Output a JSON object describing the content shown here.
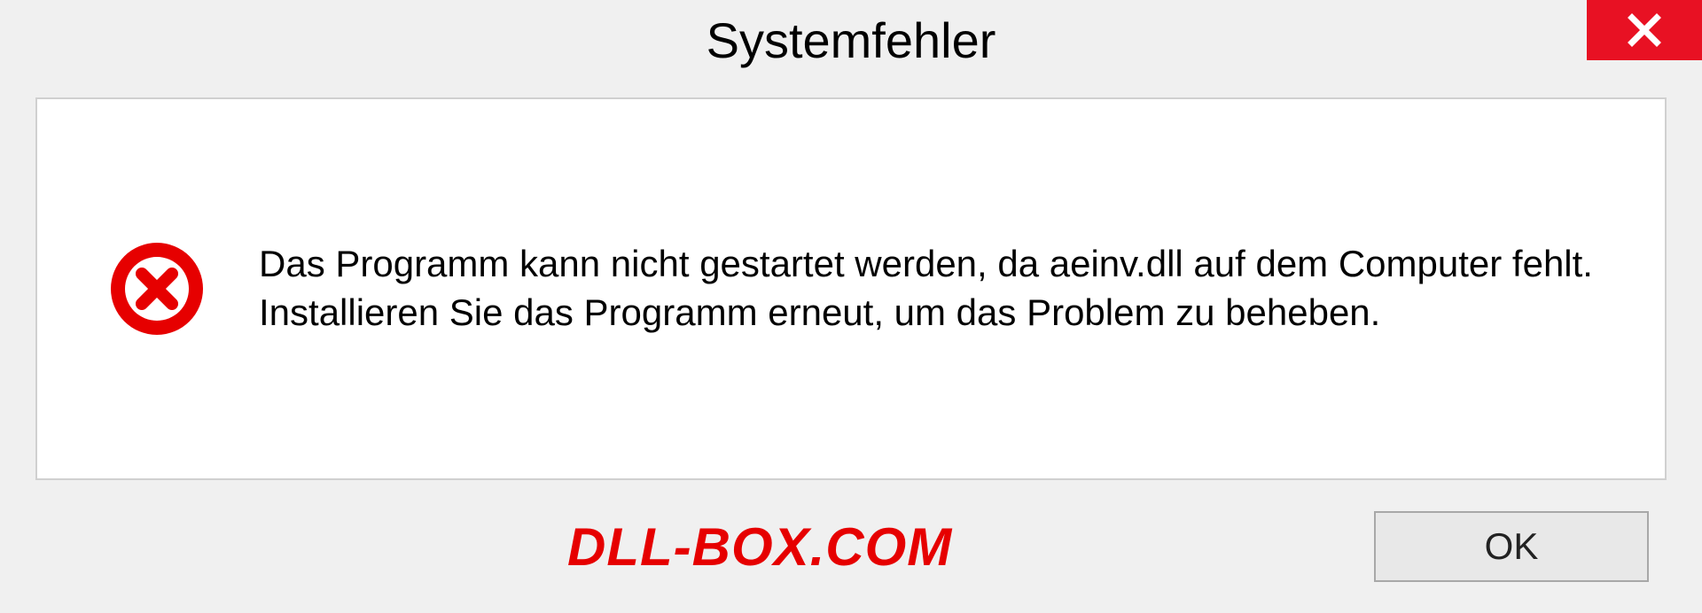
{
  "dialog": {
    "title": "Systemfehler",
    "message": "Das Programm kann nicht gestartet werden, da aeinv.dll auf dem Computer fehlt. Installieren Sie das Programm erneut, um das Problem zu beheben.",
    "ok_label": "OK"
  },
  "watermark": "DLL-BOX.COM"
}
